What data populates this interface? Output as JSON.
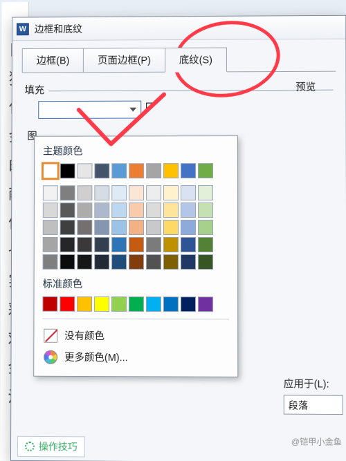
{
  "dialog": {
    "app_icon_letter": "W",
    "title": "边框和底纹",
    "tabs": [
      {
        "label": "边框(B)"
      },
      {
        "label": "页面边框(P)"
      },
      {
        "label": "底纹(S)"
      }
    ],
    "fill_label": "填充",
    "pattern_label": "图",
    "preview_label": "预览",
    "apply_to_label": "应用于(L):",
    "apply_to_value": "段落"
  },
  "popover": {
    "theme_title": "主题颜色",
    "standard_title": "标准颜色",
    "no_color": "没有颜色",
    "more_colors": "更多颜色(M)...",
    "theme_row": [
      "#ffffff",
      "#000000",
      "#e7e6e6",
      "#44546a",
      "#5b9bd5",
      "#ed7d31",
      "#a5a5a5",
      "#ffc000",
      "#4472c4",
      "#70ad47"
    ],
    "theme_tints": [
      [
        "#f2f2f2",
        "#7f7f7f",
        "#d0cece",
        "#d6dce4",
        "#deebf6",
        "#fbe5d5",
        "#ededed",
        "#fff2cc",
        "#d9e2f3",
        "#e2efd9"
      ],
      [
        "#d8d8d8",
        "#595959",
        "#aeabab",
        "#adb9ca",
        "#bdd7ee",
        "#f7cbac",
        "#dbdbdb",
        "#fee599",
        "#b4c6e7",
        "#c5e0b3"
      ],
      [
        "#bfbfbf",
        "#3f3f3f",
        "#757070",
        "#8496b0",
        "#9cc3e5",
        "#f4b183",
        "#c9c9c9",
        "#ffd965",
        "#8eaadb",
        "#a8d08d"
      ],
      [
        "#a5a5a5",
        "#262626",
        "#3a3838",
        "#323f4f",
        "#2e75b5",
        "#c55a11",
        "#7b7b7b",
        "#bf9000",
        "#2f5496",
        "#538135"
      ],
      [
        "#7f7f7f",
        "#0c0c0c",
        "#171616",
        "#222a35",
        "#1e4e79",
        "#833c0b",
        "#525252",
        "#7f6000",
        "#1f3864",
        "#375623"
      ]
    ],
    "standard_row": [
      "#c00000",
      "#ff0000",
      "#ffc000",
      "#ffff00",
      "#92d050",
      "#00b050",
      "#00b0f0",
      "#0070c0",
      "#002060",
      "#7030a0"
    ]
  },
  "background_text": [
    "目",
    "猜",
    "保",
    "金",
    "的",
    "献",
    "体",
    "也",
    "实",
    "彩",
    "戏",
    "金",
    "治"
  ],
  "footer_hint": "操作技巧",
  "watermark": "@铠甲小金鱼"
}
